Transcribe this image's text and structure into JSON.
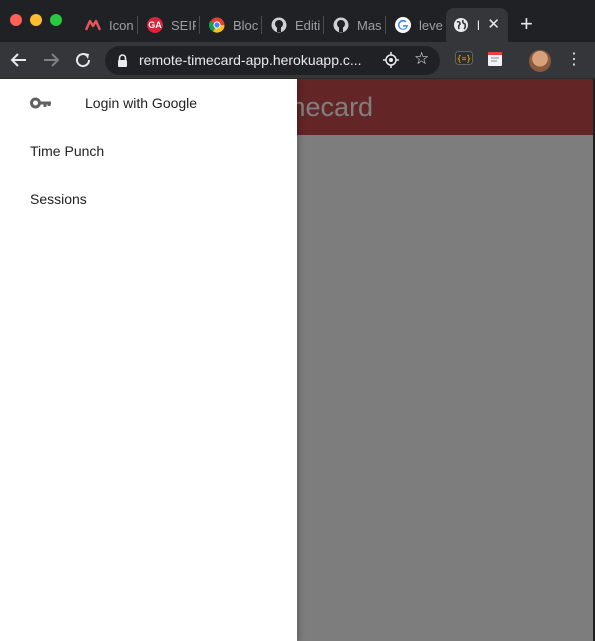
{
  "browser": {
    "tabs": [
      {
        "title": "Icon",
        "favicon": "m-logo-icon",
        "color": "#e8555a"
      },
      {
        "title": "SEIR",
        "favicon": "ga-logo-icon",
        "color": "#d6243a"
      },
      {
        "title": "Bloc",
        "favicon": "chrome-icon",
        "color": "#4285f4"
      },
      {
        "title": "Editi",
        "favicon": "github-icon",
        "color": "#ffffff"
      },
      {
        "title": "Mas",
        "favicon": "github-icon",
        "color": "#ffffff"
      },
      {
        "title": "leve",
        "favicon": "google-icon",
        "color": "#4285f4"
      },
      {
        "title": "l",
        "favicon": "globe-icon",
        "color": "#e8eaed",
        "active": true
      }
    ],
    "new_tab": "+",
    "url": "remote-timecard-app.herokuapp.c..."
  },
  "app": {
    "title": "Remote Timecard",
    "accent": "#c74b4b"
  },
  "drawer": {
    "items": [
      {
        "label": "Login with Google",
        "icon": "key-icon"
      },
      {
        "label": "Time Punch"
      },
      {
        "label": "Sessions"
      }
    ]
  }
}
